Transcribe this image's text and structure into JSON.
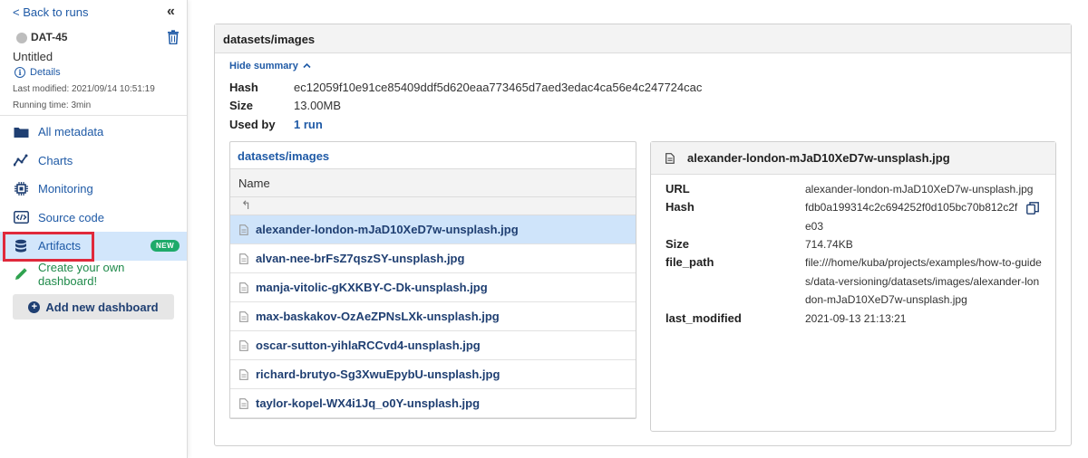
{
  "sidebar": {
    "back_link": "< Back to runs",
    "run": {
      "id": "DAT-45",
      "name": "Untitled",
      "details_label": "Details",
      "last_modified": "Last modified: 2021/09/14 10:51:19",
      "running_time": "Running time: 3min"
    },
    "nav": [
      {
        "label": "All metadata",
        "icon": "folder-icon"
      },
      {
        "label": "Charts",
        "icon": "line-chart-icon"
      },
      {
        "label": "Monitoring",
        "icon": "cpu-chip-icon"
      },
      {
        "label": "Source code",
        "icon": "code-icon"
      },
      {
        "label": "Artifacts",
        "icon": "database-icon",
        "badge": "NEW",
        "active": true
      },
      {
        "label": "Create your own dashboard!",
        "icon": "pencil-icon"
      }
    ],
    "add_dashboard_label": "Add new dashboard"
  },
  "main": {
    "title": "datasets/images",
    "hide_summary": "Hide summary",
    "summary": {
      "hash_label": "Hash",
      "hash_value": "ec12059f10e91ce85409ddf5d620eaa773465d7aed3edac4ca56e4c247724cac",
      "size_label": "Size",
      "size_value": "13.00MB",
      "used_by_label": "Used by",
      "used_by_value": "1 run"
    },
    "files": {
      "path": "datasets/images",
      "column": "Name",
      "up": "↰",
      "items": [
        "alexander-london-mJaD10XeD7w-unsplash.jpg",
        "alvan-nee-brFsZ7qszSY-unsplash.jpg",
        "manja-vitolic-gKXKBY-C-Dk-unsplash.jpg",
        "max-baskakov-OzAeZPNsLXk-unsplash.jpg",
        "oscar-sutton-yihlaRCCvd4-unsplash.jpg",
        "richard-brutyo-Sg3XwuEpybU-unsplash.jpg",
        "taylor-kopel-WX4i1Jq_o0Y-unsplash.jpg"
      ],
      "selected_index": 0
    },
    "detail": {
      "title": "alexander-london-mJaD10XeD7w-unsplash.jpg",
      "url_label": "URL",
      "url_value": "alexander-london-mJaD10XeD7w-unsplash.jpg",
      "hash_label": "Hash",
      "hash_value": "fdb0a199314c2c694252f0d105bc70b812c2fe03",
      "size_label": "Size",
      "size_value": "714.74KB",
      "file_path_label": "file_path",
      "file_path_value": "file:///home/kuba/projects/examples/how-to-guides/data-versioning/datasets/images/alexander-london-mJaD10XeD7w-unsplash.jpg",
      "last_modified_label": "last_modified",
      "last_modified_value": "2021-09-13 21:13:21"
    }
  },
  "colors": {
    "link": "#1f5aa6",
    "active_nav_bg": "#d2e6fb",
    "highlight": "#e0293b",
    "badge": "#1eaa6a",
    "create_dashboard": "#1f8a4a"
  }
}
